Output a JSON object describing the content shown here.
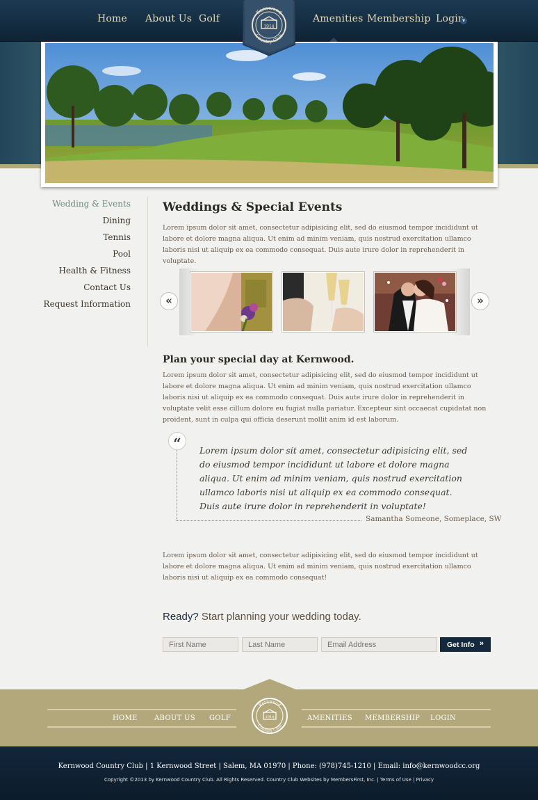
{
  "nav": {
    "home": "Home",
    "about": "About Us",
    "golf": "Golf",
    "amenities": "Amenities",
    "membership": "Membership",
    "login": "Login",
    "login_icon": "chevron-down-icon"
  },
  "badge": {
    "line1": "Kernwood",
    "year": "1914",
    "line2": "Country Club"
  },
  "sidebar": {
    "items": [
      {
        "label": "Wedding & Events",
        "active": true
      },
      {
        "label": "Dining"
      },
      {
        "label": "Tennis"
      },
      {
        "label": "Pool"
      },
      {
        "label": "Health & Fitness"
      },
      {
        "label": "Contact Us"
      },
      {
        "label": "Request Information"
      }
    ]
  },
  "main": {
    "title": "Weddings & Special Events",
    "intro": "Lorem ipsum dolor sit amet, consectetur adipisicing elit, sed do eiusmod tempor incididunt ut labore et dolore magna aliqua. Ut enim ad minim veniam, quis nostrud exercitation ullamco laboris nisi ut aliquip ex ea commodo consequat. Duis aute irure dolor in reprehenderit in voluptate.",
    "carousel": {
      "prev_icon": "double-chevron-left-icon",
      "next_icon": "double-chevron-right-icon",
      "prev": "«",
      "next": "»"
    },
    "subtitle": "Plan your special day at Kernwood.",
    "body": "Lorem ipsum dolor sit amet, consectetur adipisicing elit, sed do eiusmod tempor incididunt ut labore et dolore magna aliqua. Ut enim ad minim veniam, quis nostrud exercitation ullamco laboris nisi ut aliquip ex ea commodo consequat. Duis aute irure dolor in reprehenderit in voluptate velit esse cillum dolore eu fugiat nulla pariatur. Excepteur sint occaecat cupidatat non proident, sunt in culpa qui officia deserunt mollit anim id est laborum.",
    "quote": {
      "mark": "“",
      "text": "Lorem ipsum dolor sit amet, consectetur adipisicing elit, sed do eiusmod tempor incididunt ut labore et dolore magna aliqua. Ut enim ad minim veniam, quis nostrud exercitation ullamco laboris nisi ut aliquip ex ea commodo consequat. Duis aute irure dolor in reprehenderit in voluptate!",
      "author": "Samantha Someone, Someplace, SW"
    },
    "closing": "Lorem ipsum dolor sit amet, consectetur adipisicing elit, sed do eiusmod tempor incididunt ut labore et dolore magna aliqua. Ut enim ad minim veniam, quis nostrud exercitation ullamco laboris nisi ut aliquip ex ea commodo consequat!"
  },
  "form": {
    "heading_bold": "Ready?",
    "heading_rest": " Start planning your wedding today.",
    "first_placeholder": "First Name",
    "last_placeholder": "Last Name",
    "email_placeholder": "Email Address",
    "submit": "Get Info",
    "submit_icon": "»"
  },
  "footer": {
    "nav": {
      "home": "HOME",
      "about": "ABOUT US",
      "golf": "GOLF",
      "amenities": "AMENITIES",
      "membership": "MEMBERSHIP",
      "login": "LOGIN"
    },
    "address": "Kernwood Country Club | 1 Kernwood Street | Salem, MA 01970  | Phone: (978)745-1210 | Email: info@kernwoodcc.org",
    "copyright": "Copyright ©2013 by Kernwood Country Club. All Rights Reserved. Country Club Websites by MembersFirst, Inc. | Terms of Use | Privacy"
  },
  "colors": {
    "navy": "#0f2335",
    "gold": "#b3a77c",
    "accent_green": "#6f8a7e"
  }
}
